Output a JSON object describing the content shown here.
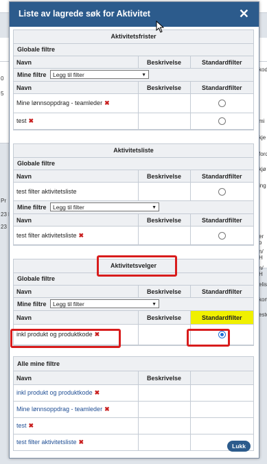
{
  "dialog": {
    "title": "Liste av lagrede søk for Aktivitet",
    "close_label": "✕",
    "lukk_label": "Lukk"
  },
  "columns": {
    "navn": "Navn",
    "beskrivelse": "Beskrivelse",
    "standardfilter": "Standardfilter"
  },
  "labels": {
    "globale_filtre": "Globale filtre",
    "mine_filtre": "Mine filtre",
    "legg_til_filter": "Legg til filter",
    "alle_mine_filtre": "Alle mine filtre"
  },
  "sections": [
    {
      "title": "Aktivitetsfrister",
      "global_rows": [],
      "my_rows": [
        {
          "name": "Mine lønnsoppdrag - teamleder",
          "selected": false
        },
        {
          "name": "test",
          "selected": false
        }
      ]
    },
    {
      "title": "Aktivitetsliste",
      "global_rows": [
        {
          "name": "test filter aktivitetsliste",
          "selected": false
        }
      ],
      "my_rows": [
        {
          "name": "test filter aktivitetsliste",
          "selected": false
        }
      ]
    },
    {
      "title": "Aktivitetsvelger",
      "global_rows": [],
      "my_rows": [
        {
          "name": "inkl produkt og produktkode",
          "selected": true
        }
      ]
    }
  ],
  "all_my_filters": [
    "inkl produkt og produktkode",
    "Mine lønnsoppdrag - teamleder",
    "test",
    "test filter aktivitetsliste"
  ],
  "background": {
    "fragments": [
      "0",
      "5",
      "kod",
      "mi",
      "kje",
      "ford",
      "kjø",
      "ing",
      "Pr",
      "23 k",
      "23",
      "er o",
      "n/ H",
      "n/ H",
      "elis",
      "kort",
      "este"
    ]
  },
  "colors": {
    "titlebar": "#2c5b8c",
    "accent_red": "#d81c1c",
    "highlight": "#f0f000",
    "link": "#1f4e94"
  }
}
